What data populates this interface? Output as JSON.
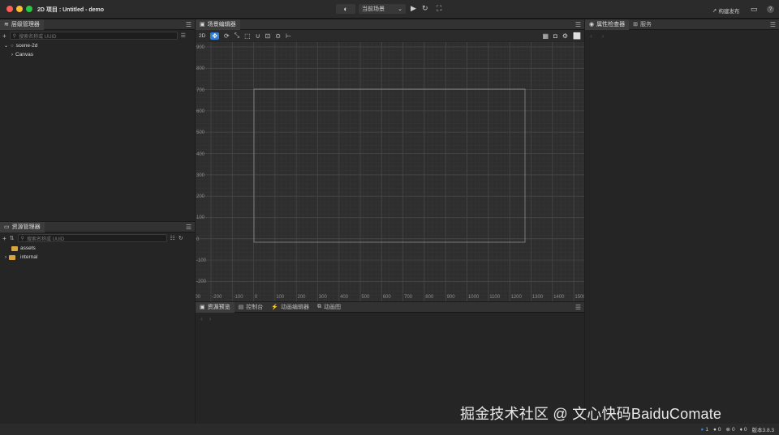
{
  "window": {
    "title": "2D 项目 : Untitled - demo",
    "scene_select": "当前场景",
    "build_label": "构建发布",
    "help": "?"
  },
  "hierarchy": {
    "tab": "层级管理器",
    "search_placeholder": "搜索名称或 UUID",
    "nodes": [
      {
        "label": "scene-2d"
      },
      {
        "label": "Canvas"
      }
    ]
  },
  "scene": {
    "tab": "场景编辑器",
    "mode": "2D",
    "y_ticks": [
      "900",
      "800",
      "700",
      "600",
      "500",
      "400",
      "300",
      "200",
      "100",
      "0",
      "-100",
      "-200"
    ],
    "x_ticks": [
      "-300",
      "-200",
      "-100",
      "0",
      "100",
      "200",
      "300",
      "400",
      "500",
      "600",
      "700",
      "800",
      "900",
      "1000",
      "1100",
      "1200",
      "1300",
      "1400",
      "1500"
    ]
  },
  "assets": {
    "tab": "资源管理器",
    "search_placeholder": "搜索名称或 UUID",
    "items": [
      {
        "label": "assets"
      },
      {
        "label": "internal"
      }
    ]
  },
  "inspector": {
    "tab": "属性检查器",
    "tab2": "服务"
  },
  "bottom": {
    "tabs": [
      "资源预览",
      "控制台",
      "动画编辑器",
      "动画图"
    ]
  },
  "status": {
    "info": "1",
    "warn": "0",
    "error": "0",
    "notice": "0",
    "version": "版本3.8.3"
  },
  "watermark": "掘金技术社区 @ 文心快码BaiduComate",
  "colors": {
    "accent": "#2f7fd6",
    "folder": "#d9a53c"
  }
}
